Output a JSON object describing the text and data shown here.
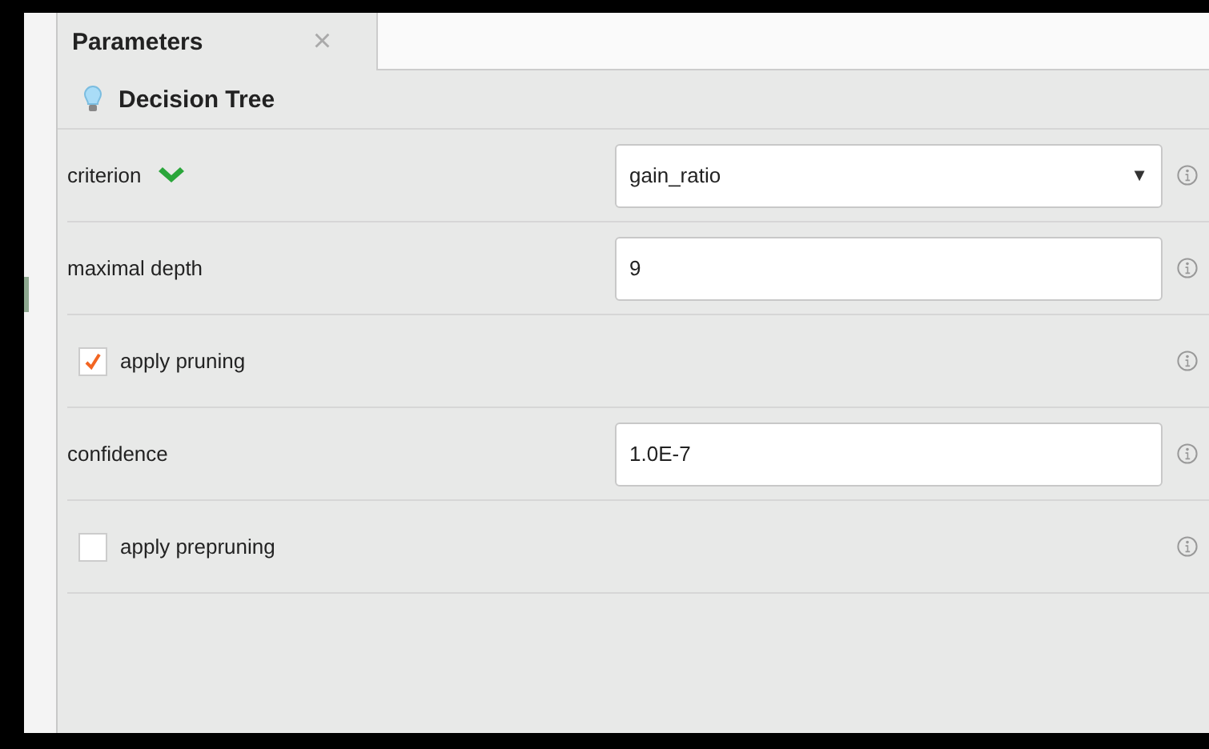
{
  "tab": {
    "label": "Parameters",
    "close": "×"
  },
  "operator": {
    "title": "Decision Tree"
  },
  "parameters": [
    {
      "kind": "select",
      "label": "criterion",
      "value": "gain_ratio",
      "caret": "▼",
      "expanded": true
    },
    {
      "kind": "text",
      "label": "maximal depth",
      "value": "9"
    },
    {
      "kind": "checkbox",
      "label": "apply pruning",
      "checked": true
    },
    {
      "kind": "text",
      "label": "confidence",
      "value": "1.0E-7"
    },
    {
      "kind": "checkbox",
      "label": "apply prepruning",
      "checked": false
    }
  ]
}
